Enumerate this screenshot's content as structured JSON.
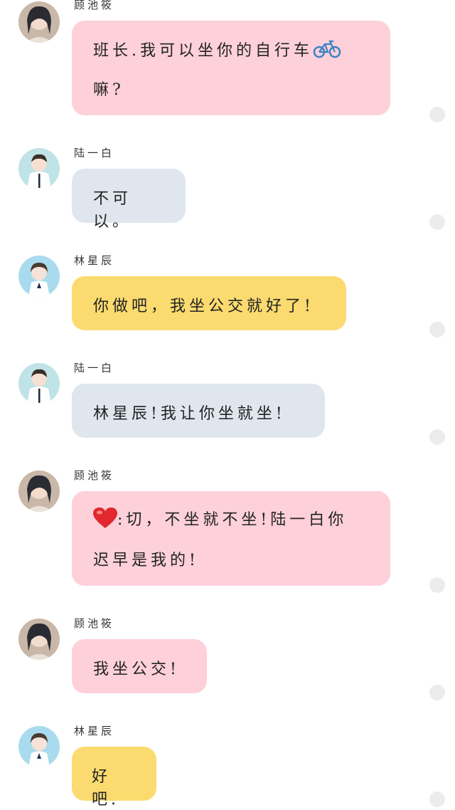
{
  "colors": {
    "pink_bubble": "#fdd0da",
    "gray_bubble": "#dfe6ee",
    "yellow_bubble": "#fbdb6f",
    "status_dot": "#ececec"
  },
  "messages": [
    {
      "sender": "顾池筱",
      "text": "班长.我可以坐你的自行车",
      "text_after_icon": "嘛?",
      "icon": "bicycle-icon",
      "bubble": "pink"
    },
    {
      "sender": "陆一白",
      "text": "不可以。",
      "bubble": "gray"
    },
    {
      "sender": "林星辰",
      "text": "你做吧，我坐公交就好了!",
      "bubble": "yellow"
    },
    {
      "sender": "陆一白",
      "text": "林星辰!我让你坐就坐!",
      "bubble": "gray"
    },
    {
      "sender": "顾池筱",
      "icon": "heart-icon",
      "text": ":切，不坐就不坐!陆一白你",
      "text_line2": "迟早是我的!",
      "bubble": "pink"
    },
    {
      "sender": "顾池筱",
      "text": "我坐公交!",
      "bubble": "pink"
    },
    {
      "sender": "林星辰",
      "text": "好吧.",
      "bubble": "yellow"
    }
  ]
}
